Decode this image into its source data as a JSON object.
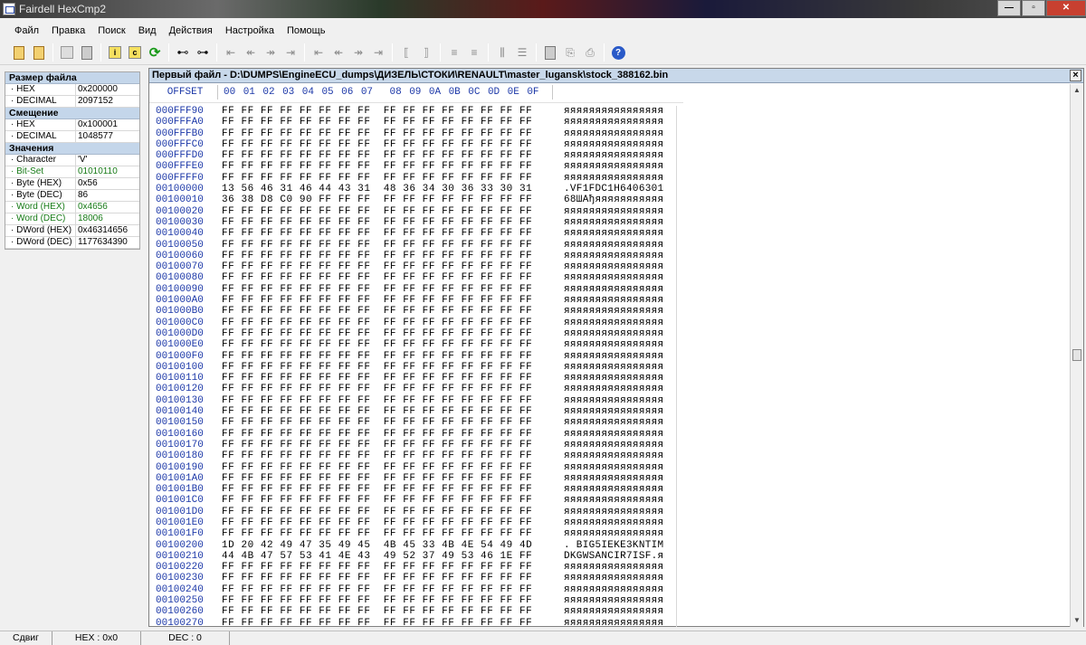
{
  "window": {
    "title": "Fairdell HexCmp2"
  },
  "menu": [
    "Файл",
    "Правка",
    "Поиск",
    "Вид",
    "Действия",
    "Настройка",
    "Помощь"
  ],
  "toolbar_icons": [
    "open-file-icon",
    "open-second-file-icon",
    "stop-icon",
    "close-file-icon",
    "info-icon",
    "compare-icon",
    "refresh-icon",
    "find-icon",
    "find-next-icon",
    "first-diff-icon",
    "prev-diff-icon",
    "next-diff-icon",
    "last-diff-icon",
    "first-page-icon",
    "prev-page-icon",
    "next-page-icon",
    "last-page-icon",
    "sync-left-icon",
    "sync-right-icon",
    "align-left-icon",
    "align-right-icon",
    "columns-icon",
    "rows-icon",
    "report-icon",
    "export-icon",
    "print-icon",
    "help-icon"
  ],
  "info_panel": {
    "sections": [
      {
        "header": "Размер файла",
        "rows": [
          {
            "key": "· HEX",
            "value": "0x200000",
            "green": false
          },
          {
            "key": "· DECIMAL",
            "value": "2097152",
            "green": false
          }
        ]
      },
      {
        "header": "Смещение",
        "rows": [
          {
            "key": "· HEX",
            "value": "0x100001",
            "green": false
          },
          {
            "key": "· DECIMAL",
            "value": "1048577",
            "green": false
          }
        ]
      },
      {
        "header": "Значения",
        "rows": [
          {
            "key": "· Character",
            "value": "'V'",
            "green": false
          },
          {
            "key": "· Bit-Set",
            "value": "01010110",
            "green": true
          },
          {
            "key": "· Byte (HEX)",
            "value": "0x56",
            "green": false
          },
          {
            "key": "· Byte (DEC)",
            "value": "86",
            "green": false
          },
          {
            "key": "· Word (HEX)",
            "value": "0x4656",
            "green": true
          },
          {
            "key": "· Word (DEC)",
            "value": "18006",
            "green": true
          },
          {
            "key": "· DWord (HEX)",
            "value": "0x46314656",
            "green": false
          },
          {
            "key": "· DWord (DEC)",
            "value": "1177634390",
            "green": false
          }
        ]
      }
    ]
  },
  "hex_panel": {
    "title": "Первый файл - D:\\DUMPS\\EngineECU_dumps\\ДИЗЕЛЬ\\СТОКИ\\RENAULT\\master_lugansk\\stock_388162.bin",
    "close_label": "×",
    "offset_header": "OFFSET",
    "column_headers": [
      "00",
      "01",
      "02",
      "03",
      "04",
      "05",
      "06",
      "07",
      "08",
      "09",
      "0A",
      "0B",
      "0C",
      "0D",
      "0E",
      "0F"
    ],
    "rows": [
      {
        "offset": "000FFF90",
        "bytes": "FF FF FF FF FF FF FF FF  FF FF FF FF FF FF FF FF",
        "ascii": "яяяяяяяяяяяяяяяя"
      },
      {
        "offset": "000FFFA0",
        "bytes": "FF FF FF FF FF FF FF FF  FF FF FF FF FF FF FF FF",
        "ascii": "яяяяяяяяяяяяяяяя"
      },
      {
        "offset": "000FFFB0",
        "bytes": "FF FF FF FF FF FF FF FF  FF FF FF FF FF FF FF FF",
        "ascii": "яяяяяяяяяяяяяяяя"
      },
      {
        "offset": "000FFFC0",
        "bytes": "FF FF FF FF FF FF FF FF  FF FF FF FF FF FF FF FF",
        "ascii": "яяяяяяяяяяяяяяяя"
      },
      {
        "offset": "000FFFD0",
        "bytes": "FF FF FF FF FF FF FF FF  FF FF FF FF FF FF FF FF",
        "ascii": "яяяяяяяяяяяяяяяя"
      },
      {
        "offset": "000FFFE0",
        "bytes": "FF FF FF FF FF FF FF FF  FF FF FF FF FF FF FF FF",
        "ascii": "яяяяяяяяяяяяяяяя"
      },
      {
        "offset": "000FFFF0",
        "bytes": "FF FF FF FF FF FF FF FF  FF FF FF FF FF FF FF FF",
        "ascii": "яяяяяяяяяяяяяяяя"
      },
      {
        "offset": "00100000",
        "bytes": "13 56 46 31 46 44 43 31  48 36 34 30 36 33 30 31",
        "ascii": ".VF1FDC1H6406301"
      },
      {
        "offset": "00100010",
        "bytes": "36 38 D8 C0 90 FF FF FF  FF FF FF FF FF FF FF FF",
        "ascii": "68ШАђяяяяяяяяяяя"
      },
      {
        "offset": "00100020",
        "bytes": "FF FF FF FF FF FF FF FF  FF FF FF FF FF FF FF FF",
        "ascii": "яяяяяяяяяяяяяяяя"
      },
      {
        "offset": "00100030",
        "bytes": "FF FF FF FF FF FF FF FF  FF FF FF FF FF FF FF FF",
        "ascii": "яяяяяяяяяяяяяяяя"
      },
      {
        "offset": "00100040",
        "bytes": "FF FF FF FF FF FF FF FF  FF FF FF FF FF FF FF FF",
        "ascii": "яяяяяяяяяяяяяяяя"
      },
      {
        "offset": "00100050",
        "bytes": "FF FF FF FF FF FF FF FF  FF FF FF FF FF FF FF FF",
        "ascii": "яяяяяяяяяяяяяяяя"
      },
      {
        "offset": "00100060",
        "bytes": "FF FF FF FF FF FF FF FF  FF FF FF FF FF FF FF FF",
        "ascii": "яяяяяяяяяяяяяяяя"
      },
      {
        "offset": "00100070",
        "bytes": "FF FF FF FF FF FF FF FF  FF FF FF FF FF FF FF FF",
        "ascii": "яяяяяяяяяяяяяяяя"
      },
      {
        "offset": "00100080",
        "bytes": "FF FF FF FF FF FF FF FF  FF FF FF FF FF FF FF FF",
        "ascii": "яяяяяяяяяяяяяяяя"
      },
      {
        "offset": "00100090",
        "bytes": "FF FF FF FF FF FF FF FF  FF FF FF FF FF FF FF FF",
        "ascii": "яяяяяяяяяяяяяяяя"
      },
      {
        "offset": "001000A0",
        "bytes": "FF FF FF FF FF FF FF FF  FF FF FF FF FF FF FF FF",
        "ascii": "яяяяяяяяяяяяяяяя"
      },
      {
        "offset": "001000B0",
        "bytes": "FF FF FF FF FF FF FF FF  FF FF FF FF FF FF FF FF",
        "ascii": "яяяяяяяяяяяяяяяя"
      },
      {
        "offset": "001000C0",
        "bytes": "FF FF FF FF FF FF FF FF  FF FF FF FF FF FF FF FF",
        "ascii": "яяяяяяяяяяяяяяяя"
      },
      {
        "offset": "001000D0",
        "bytes": "FF FF FF FF FF FF FF FF  FF FF FF FF FF FF FF FF",
        "ascii": "яяяяяяяяяяяяяяяя"
      },
      {
        "offset": "001000E0",
        "bytes": "FF FF FF FF FF FF FF FF  FF FF FF FF FF FF FF FF",
        "ascii": "яяяяяяяяяяяяяяяя"
      },
      {
        "offset": "001000F0",
        "bytes": "FF FF FF FF FF FF FF FF  FF FF FF FF FF FF FF FF",
        "ascii": "яяяяяяяяяяяяяяяя"
      },
      {
        "offset": "00100100",
        "bytes": "FF FF FF FF FF FF FF FF  FF FF FF FF FF FF FF FF",
        "ascii": "яяяяяяяяяяяяяяяя"
      },
      {
        "offset": "00100110",
        "bytes": "FF FF FF FF FF FF FF FF  FF FF FF FF FF FF FF FF",
        "ascii": "яяяяяяяяяяяяяяяя"
      },
      {
        "offset": "00100120",
        "bytes": "FF FF FF FF FF FF FF FF  FF FF FF FF FF FF FF FF",
        "ascii": "яяяяяяяяяяяяяяяя"
      },
      {
        "offset": "00100130",
        "bytes": "FF FF FF FF FF FF FF FF  FF FF FF FF FF FF FF FF",
        "ascii": "яяяяяяяяяяяяяяяя"
      },
      {
        "offset": "00100140",
        "bytes": "FF FF FF FF FF FF FF FF  FF FF FF FF FF FF FF FF",
        "ascii": "яяяяяяяяяяяяяяяя"
      },
      {
        "offset": "00100150",
        "bytes": "FF FF FF FF FF FF FF FF  FF FF FF FF FF FF FF FF",
        "ascii": "яяяяяяяяяяяяяяяя"
      },
      {
        "offset": "00100160",
        "bytes": "FF FF FF FF FF FF FF FF  FF FF FF FF FF FF FF FF",
        "ascii": "яяяяяяяяяяяяяяяя"
      },
      {
        "offset": "00100170",
        "bytes": "FF FF FF FF FF FF FF FF  FF FF FF FF FF FF FF FF",
        "ascii": "яяяяяяяяяяяяяяяя"
      },
      {
        "offset": "00100180",
        "bytes": "FF FF FF FF FF FF FF FF  FF FF FF FF FF FF FF FF",
        "ascii": "яяяяяяяяяяяяяяяя"
      },
      {
        "offset": "00100190",
        "bytes": "FF FF FF FF FF FF FF FF  FF FF FF FF FF FF FF FF",
        "ascii": "яяяяяяяяяяяяяяяя"
      },
      {
        "offset": "001001A0",
        "bytes": "FF FF FF FF FF FF FF FF  FF FF FF FF FF FF FF FF",
        "ascii": "яяяяяяяяяяяяяяяя"
      },
      {
        "offset": "001001B0",
        "bytes": "FF FF FF FF FF FF FF FF  FF FF FF FF FF FF FF FF",
        "ascii": "яяяяяяяяяяяяяяяя"
      },
      {
        "offset": "001001C0",
        "bytes": "FF FF FF FF FF FF FF FF  FF FF FF FF FF FF FF FF",
        "ascii": "яяяяяяяяяяяяяяяя"
      },
      {
        "offset": "001001D0",
        "bytes": "FF FF FF FF FF FF FF FF  FF FF FF FF FF FF FF FF",
        "ascii": "яяяяяяяяяяяяяяяя"
      },
      {
        "offset": "001001E0",
        "bytes": "FF FF FF FF FF FF FF FF  FF FF FF FF FF FF FF FF",
        "ascii": "яяяяяяяяяяяяяяяя"
      },
      {
        "offset": "001001F0",
        "bytes": "FF FF FF FF FF FF FF FF  FF FF FF FF FF FF FF FF",
        "ascii": "яяяяяяяяяяяяяяяя"
      },
      {
        "offset": "00100200",
        "bytes": "1D 20 42 49 47 35 49 45  4B 45 33 4B 4E 54 49 4D",
        "ascii": ". BIG5IEKE3KNTIM"
      },
      {
        "offset": "00100210",
        "bytes": "44 4B 47 57 53 41 4E 43  49 52 37 49 53 46 1E FF",
        "ascii": "DKGWSANCIR7ISF.я"
      },
      {
        "offset": "00100220",
        "bytes": "FF FF FF FF FF FF FF FF  FF FF FF FF FF FF FF FF",
        "ascii": "яяяяяяяяяяяяяяяя"
      },
      {
        "offset": "00100230",
        "bytes": "FF FF FF FF FF FF FF FF  FF FF FF FF FF FF FF FF",
        "ascii": "яяяяяяяяяяяяяяяя"
      },
      {
        "offset": "00100240",
        "bytes": "FF FF FF FF FF FF FF FF  FF FF FF FF FF FF FF FF",
        "ascii": "яяяяяяяяяяяяяяяя"
      },
      {
        "offset": "00100250",
        "bytes": "FF FF FF FF FF FF FF FF  FF FF FF FF FF FF FF FF",
        "ascii": "яяяяяяяяяяяяяяяя"
      },
      {
        "offset": "00100260",
        "bytes": "FF FF FF FF FF FF FF FF  FF FF FF FF FF FF FF FF",
        "ascii": "яяяяяяяяяяяяяяяя"
      },
      {
        "offset": "00100270",
        "bytes": "FF FF FF FF FF FF FF FF  FF FF FF FF FF FF FF FF",
        "ascii": "яяяяяяяяяяяяяяяя"
      }
    ]
  },
  "status": {
    "shift": "Сдвиг",
    "hex": "HEX : 0x0",
    "dec": "DEC : 0"
  }
}
